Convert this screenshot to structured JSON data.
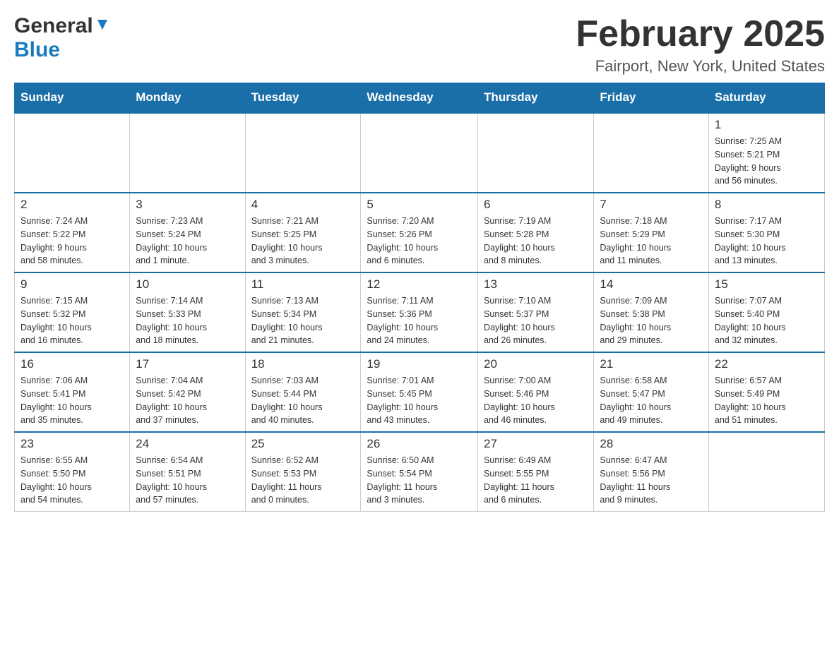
{
  "header": {
    "logo": {
      "general": "General",
      "blue": "Blue"
    },
    "title": "February 2025",
    "location": "Fairport, New York, United States"
  },
  "weekdays": [
    "Sunday",
    "Monday",
    "Tuesday",
    "Wednesday",
    "Thursday",
    "Friday",
    "Saturday"
  ],
  "weeks": [
    [
      {
        "day": "",
        "info": ""
      },
      {
        "day": "",
        "info": ""
      },
      {
        "day": "",
        "info": ""
      },
      {
        "day": "",
        "info": ""
      },
      {
        "day": "",
        "info": ""
      },
      {
        "day": "",
        "info": ""
      },
      {
        "day": "1",
        "info": "Sunrise: 7:25 AM\nSunset: 5:21 PM\nDaylight: 9 hours\nand 56 minutes."
      }
    ],
    [
      {
        "day": "2",
        "info": "Sunrise: 7:24 AM\nSunset: 5:22 PM\nDaylight: 9 hours\nand 58 minutes."
      },
      {
        "day": "3",
        "info": "Sunrise: 7:23 AM\nSunset: 5:24 PM\nDaylight: 10 hours\nand 1 minute."
      },
      {
        "day": "4",
        "info": "Sunrise: 7:21 AM\nSunset: 5:25 PM\nDaylight: 10 hours\nand 3 minutes."
      },
      {
        "day": "5",
        "info": "Sunrise: 7:20 AM\nSunset: 5:26 PM\nDaylight: 10 hours\nand 6 minutes."
      },
      {
        "day": "6",
        "info": "Sunrise: 7:19 AM\nSunset: 5:28 PM\nDaylight: 10 hours\nand 8 minutes."
      },
      {
        "day": "7",
        "info": "Sunrise: 7:18 AM\nSunset: 5:29 PM\nDaylight: 10 hours\nand 11 minutes."
      },
      {
        "day": "8",
        "info": "Sunrise: 7:17 AM\nSunset: 5:30 PM\nDaylight: 10 hours\nand 13 minutes."
      }
    ],
    [
      {
        "day": "9",
        "info": "Sunrise: 7:15 AM\nSunset: 5:32 PM\nDaylight: 10 hours\nand 16 minutes."
      },
      {
        "day": "10",
        "info": "Sunrise: 7:14 AM\nSunset: 5:33 PM\nDaylight: 10 hours\nand 18 minutes."
      },
      {
        "day": "11",
        "info": "Sunrise: 7:13 AM\nSunset: 5:34 PM\nDaylight: 10 hours\nand 21 minutes."
      },
      {
        "day": "12",
        "info": "Sunrise: 7:11 AM\nSunset: 5:36 PM\nDaylight: 10 hours\nand 24 minutes."
      },
      {
        "day": "13",
        "info": "Sunrise: 7:10 AM\nSunset: 5:37 PM\nDaylight: 10 hours\nand 26 minutes."
      },
      {
        "day": "14",
        "info": "Sunrise: 7:09 AM\nSunset: 5:38 PM\nDaylight: 10 hours\nand 29 minutes."
      },
      {
        "day": "15",
        "info": "Sunrise: 7:07 AM\nSunset: 5:40 PM\nDaylight: 10 hours\nand 32 minutes."
      }
    ],
    [
      {
        "day": "16",
        "info": "Sunrise: 7:06 AM\nSunset: 5:41 PM\nDaylight: 10 hours\nand 35 minutes."
      },
      {
        "day": "17",
        "info": "Sunrise: 7:04 AM\nSunset: 5:42 PM\nDaylight: 10 hours\nand 37 minutes."
      },
      {
        "day": "18",
        "info": "Sunrise: 7:03 AM\nSunset: 5:44 PM\nDaylight: 10 hours\nand 40 minutes."
      },
      {
        "day": "19",
        "info": "Sunrise: 7:01 AM\nSunset: 5:45 PM\nDaylight: 10 hours\nand 43 minutes."
      },
      {
        "day": "20",
        "info": "Sunrise: 7:00 AM\nSunset: 5:46 PM\nDaylight: 10 hours\nand 46 minutes."
      },
      {
        "day": "21",
        "info": "Sunrise: 6:58 AM\nSunset: 5:47 PM\nDaylight: 10 hours\nand 49 minutes."
      },
      {
        "day": "22",
        "info": "Sunrise: 6:57 AM\nSunset: 5:49 PM\nDaylight: 10 hours\nand 51 minutes."
      }
    ],
    [
      {
        "day": "23",
        "info": "Sunrise: 6:55 AM\nSunset: 5:50 PM\nDaylight: 10 hours\nand 54 minutes."
      },
      {
        "day": "24",
        "info": "Sunrise: 6:54 AM\nSunset: 5:51 PM\nDaylight: 10 hours\nand 57 minutes."
      },
      {
        "day": "25",
        "info": "Sunrise: 6:52 AM\nSunset: 5:53 PM\nDaylight: 11 hours\nand 0 minutes."
      },
      {
        "day": "26",
        "info": "Sunrise: 6:50 AM\nSunset: 5:54 PM\nDaylight: 11 hours\nand 3 minutes."
      },
      {
        "day": "27",
        "info": "Sunrise: 6:49 AM\nSunset: 5:55 PM\nDaylight: 11 hours\nand 6 minutes."
      },
      {
        "day": "28",
        "info": "Sunrise: 6:47 AM\nSunset: 5:56 PM\nDaylight: 11 hours\nand 9 minutes."
      },
      {
        "day": "",
        "info": ""
      }
    ]
  ]
}
